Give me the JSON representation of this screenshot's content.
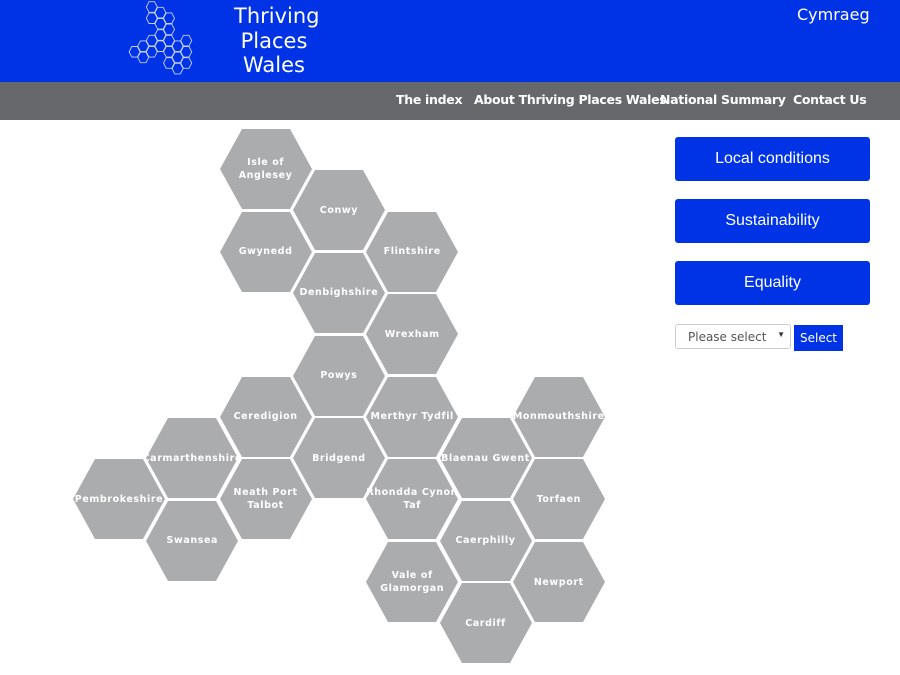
{
  "header": {
    "brand_lines": [
      "Thriving",
      "Places",
      "Wales"
    ],
    "language_link": "Cymraeg",
    "logo_icon": "hexagon-cluster-logo"
  },
  "nav": {
    "items": [
      {
        "label": "The index"
      },
      {
        "label": "About Thriving Places Wales"
      },
      {
        "label": "National Summary"
      },
      {
        "label": "Contact Us"
      }
    ]
  },
  "colors": {
    "brand_blue": "#0033e6",
    "nav_grey": "#66686b",
    "hex_grey": "#abacae"
  },
  "map": {
    "regions": [
      {
        "name": "Isle of Anglesey",
        "col": 2,
        "row": 0
      },
      {
        "name": "Conwy",
        "col": 3,
        "row": 1
      },
      {
        "name": "Gwynedd",
        "col": 2,
        "row": 2
      },
      {
        "name": "Flintshire",
        "col": 4,
        "row": 2
      },
      {
        "name": "Denbighshire",
        "col": 3,
        "row": 3
      },
      {
        "name": "Wrexham",
        "col": 4,
        "row": 4
      },
      {
        "name": "Powys",
        "col": 3,
        "row": 5
      },
      {
        "name": "Ceredigion",
        "col": 2,
        "row": 6
      },
      {
        "name": "Merthyr Tydfil",
        "col": 4,
        "row": 6
      },
      {
        "name": "Monmouthshire",
        "col": 6,
        "row": 6
      },
      {
        "name": "Carmarthenshire",
        "col": 1,
        "row": 7
      },
      {
        "name": "Bridgend",
        "col": 3,
        "row": 7
      },
      {
        "name": "Blaenau Gwent",
        "col": 5,
        "row": 7
      },
      {
        "name": "Pembrokeshire",
        "col": 0,
        "row": 8
      },
      {
        "name": "Neath Port Talbot",
        "col": 2,
        "row": 8
      },
      {
        "name": "Rhondda Cynon Taf",
        "col": 4,
        "row": 8
      },
      {
        "name": "Torfaen",
        "col": 6,
        "row": 8
      },
      {
        "name": "Swansea",
        "col": 1,
        "row": 9
      },
      {
        "name": "Caerphilly",
        "col": 5,
        "row": 9
      },
      {
        "name": "Vale of Glamorgan",
        "col": 4,
        "row": 10
      },
      {
        "name": "Newport",
        "col": 6,
        "row": 10
      },
      {
        "name": "Cardiff",
        "col": 5,
        "row": 11
      }
    ]
  },
  "sidebar": {
    "buttons": [
      {
        "label": "Local conditions"
      },
      {
        "label": "Sustainability"
      },
      {
        "label": "Equality"
      }
    ],
    "dropdown": {
      "placeholder": "Please select"
    },
    "select_button": "Select"
  }
}
